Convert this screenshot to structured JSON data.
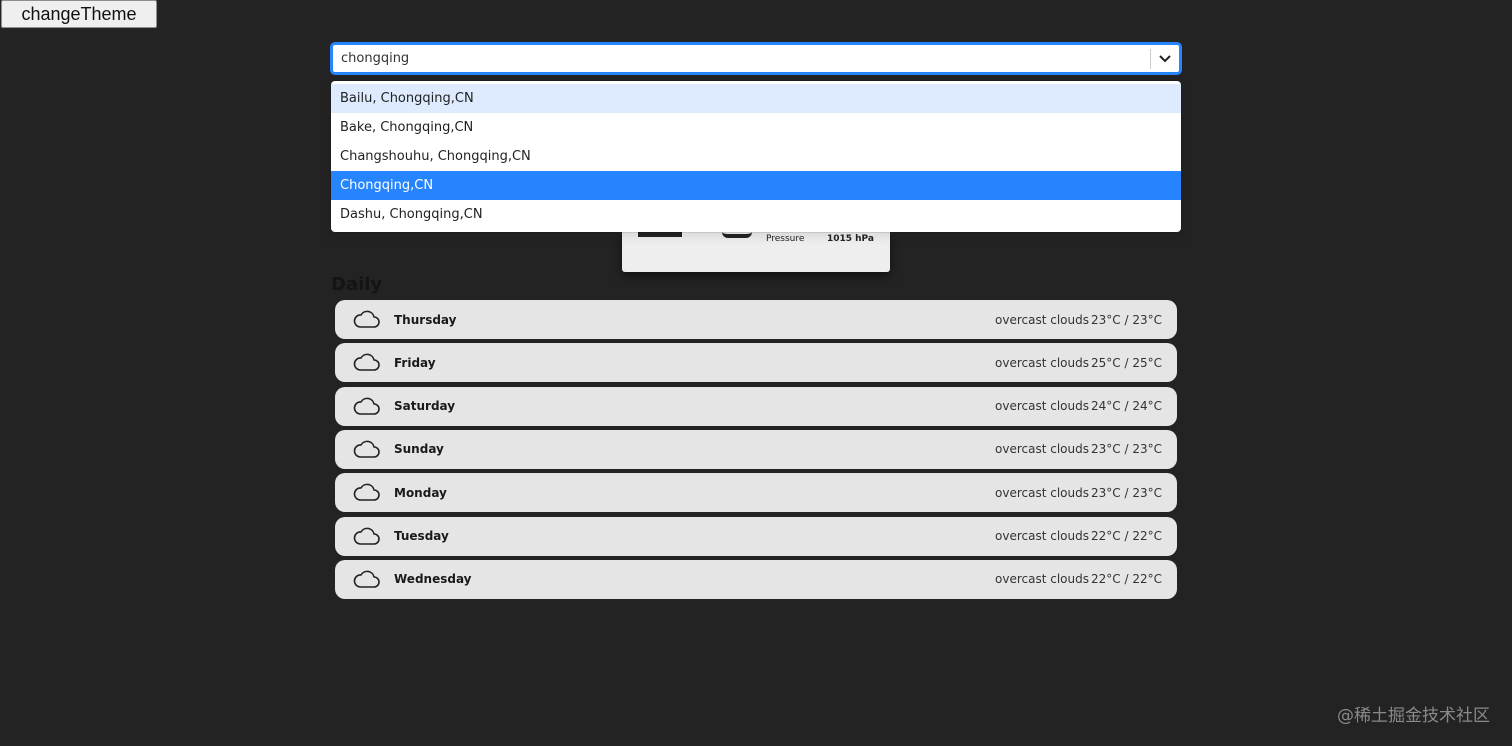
{
  "theme_button": {
    "label": "changeTheme"
  },
  "search": {
    "value": "chongqing",
    "options": [
      {
        "label": "Bailu, Chongqing,CN",
        "state": "focused"
      },
      {
        "label": "Bake, Chongqing,CN",
        "state": ""
      },
      {
        "label": "Changshouhu, Chongqing,CN",
        "state": ""
      },
      {
        "label": "Chongqing,CN",
        "state": "selected"
      },
      {
        "label": "Dashu, Chongqing,CN",
        "state": ""
      }
    ]
  },
  "current": {
    "pressure_label": "Pressure",
    "pressure_value": "1015 hPa"
  },
  "daily": {
    "title": "Daily",
    "days": [
      {
        "day": "Thursday",
        "description": "overcast clouds",
        "temp": "23°C / 23°C",
        "icon": "cloud-icon"
      },
      {
        "day": "Friday",
        "description": "overcast clouds",
        "temp": "25°C / 25°C",
        "icon": "cloud-icon"
      },
      {
        "day": "Saturday",
        "description": "overcast clouds",
        "temp": "24°C / 24°C",
        "icon": "cloud-icon"
      },
      {
        "day": "Sunday",
        "description": "overcast clouds",
        "temp": "23°C / 23°C",
        "icon": "cloud-icon"
      },
      {
        "day": "Monday",
        "description": "overcast clouds",
        "temp": "23°C / 23°C",
        "icon": "cloud-icon"
      },
      {
        "day": "Tuesday",
        "description": "overcast clouds",
        "temp": "22°C / 22°C",
        "icon": "cloud-icon"
      },
      {
        "day": "Wednesday",
        "description": "overcast clouds",
        "temp": "22°C / 22°C",
        "icon": "cloud-icon"
      }
    ]
  },
  "watermark": "@稀土掘金技术社区",
  "colors": {
    "background": "#232323",
    "accent": "#2684ff",
    "option_focus": "#deebff",
    "row_bg": "#e5e5e5"
  }
}
